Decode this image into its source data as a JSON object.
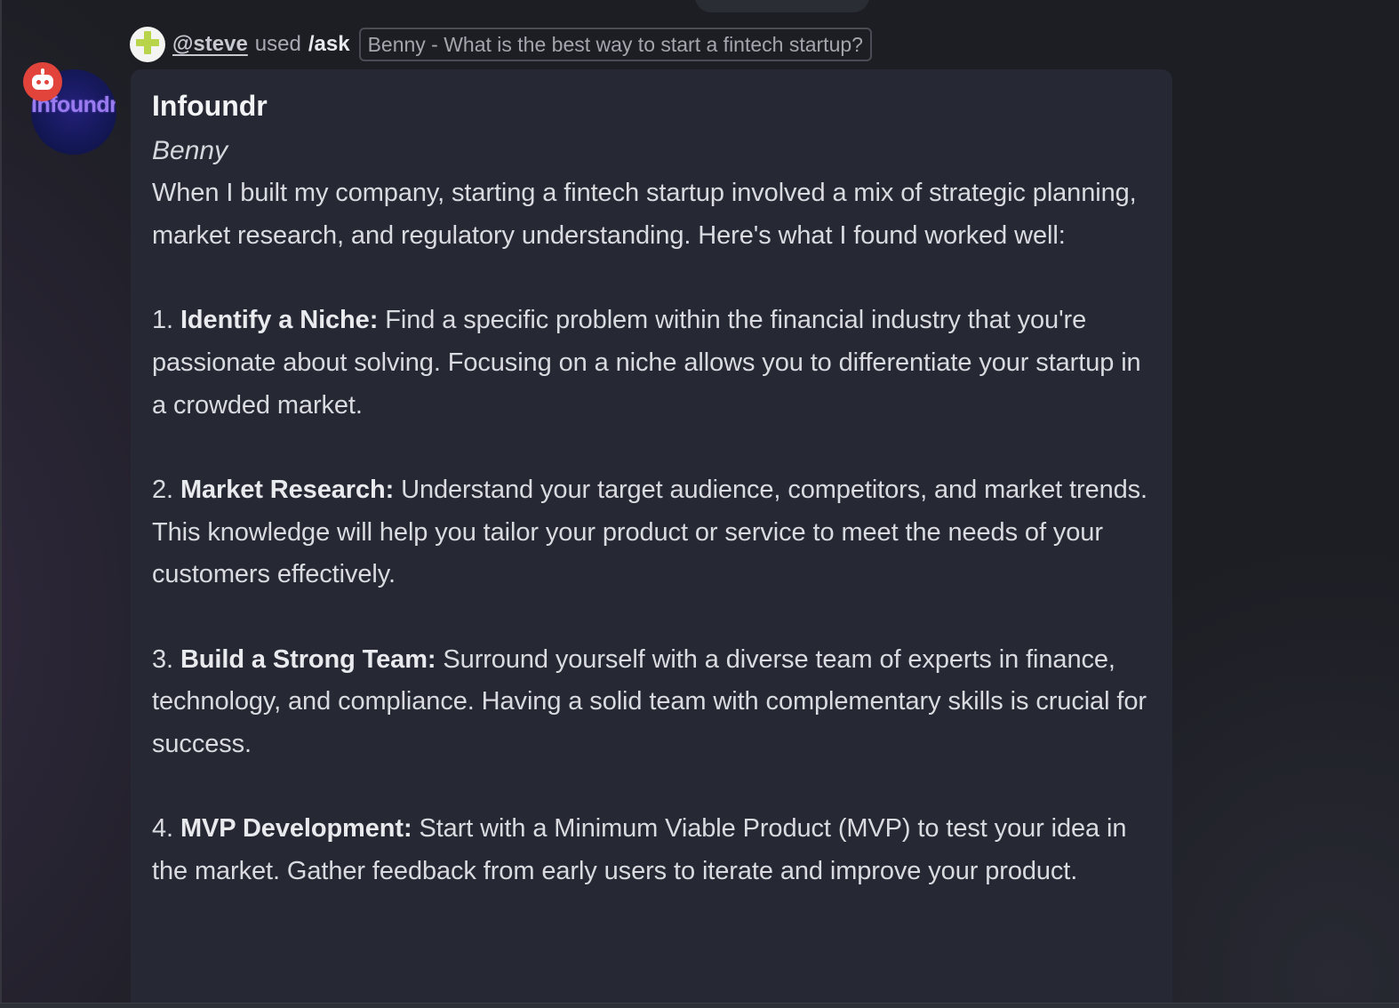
{
  "command": {
    "user": "@steve",
    "used_text": "used",
    "command_name": "/ask",
    "query": "Benny - What is the best way to start a fintech startup?"
  },
  "bot": {
    "avatar_logo_text": "Infoundr",
    "name": "Infoundr",
    "persona": "Benny"
  },
  "message": {
    "intro": "When I built my company, starting a fintech startup involved a mix of strategic planning, market research, and regulatory understanding. Here's what I found worked well:",
    "items": [
      {
        "number": "1.",
        "title": "Identify a Niche:",
        "text": "Find a specific problem within the financial industry that you're passionate about solving. Focusing on a niche allows you to differentiate your startup in a crowded market."
      },
      {
        "number": "2.",
        "title": "Market Research:",
        "text": "Understand your target audience, competitors, and market trends. This knowledge will help you tailor your product or service to meet the needs of your customers effectively."
      },
      {
        "number": "3.",
        "title": "Build a Strong Team:",
        "text": "Surround yourself with a diverse team of experts in finance, technology, and compliance. Having a solid team with complementary skills is crucial for success."
      },
      {
        "number": "4.",
        "title": "MVP Development:",
        "text": "Start with a Minimum Viable Product (MVP) to test your idea in the market. Gather feedback from early users to iterate and improve your product."
      }
    ]
  },
  "icons": {
    "command_avatar": "plus-avatar-icon",
    "bot_badge": "robot-icon"
  },
  "colors": {
    "background": "#1d1e24",
    "card": "#262833",
    "bot_badge": "#e2443c",
    "avatar_plus": "#b8d44a",
    "logo_text": "#9b7cf0"
  }
}
